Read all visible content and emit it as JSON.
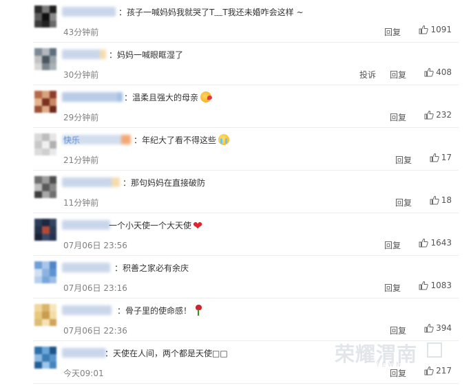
{
  "comments": [
    {
      "text": "：孩子一喊妈妈我就哭了T﹏T我还未婚咋会这样 ~",
      "time": "43分钟前",
      "reply": "回复",
      "report": "",
      "likes": "1091",
      "username": "",
      "emoji": "",
      "avatar_colors": [
        "#2b2b2b",
        "#7a7a7a",
        "#1e1e1e",
        "#5c5c5c",
        "#0f0f0f",
        "#8a8a8a",
        "#3a3a3a",
        "#222222",
        "#6a6a6a"
      ],
      "name_colors": [
        "#c9d6ea",
        "#b9c9e3"
      ]
    },
    {
      "text": "：妈妈一喊眼眶湿了",
      "time": "30分钟前",
      "reply": "回复",
      "report": "投诉",
      "likes": "408",
      "username": "",
      "emoji": "",
      "avatar_colors": [
        "#7b8a96",
        "#b3b8bd",
        "#5d6f7d",
        "#c2c2c2",
        "#4a5560",
        "#9aa4ab",
        "#d8d8d8",
        "#7c858c",
        "#a9b1b7"
      ],
      "name_colors": [
        "#c9d6ea",
        "#f5dcae"
      ]
    },
    {
      "text": "：温柔且强大的母亲",
      "time": "29分钟前",
      "reply": "回复",
      "report": "",
      "likes": "232",
      "username": "",
      "emoji": "kiss",
      "avatar_colors": [
        "#b56a4a",
        "#d9a17c",
        "#8c3e2c",
        "#e4b48e",
        "#7a3122",
        "#c98a63",
        "#9b5138",
        "#deae8a",
        "#6a2a1c"
      ],
      "name_colors": [
        "#b9cbe6",
        "#9fbde6"
      ]
    },
    {
      "text": "：年纪大了看不得这些",
      "time": "21分钟前",
      "reply": "回复",
      "report": "",
      "likes": "17",
      "username": "快乐",
      "emoji": "cry",
      "avatar_colors": [
        "#d9d9d9",
        "#bdbdbd",
        "#e6e6e6",
        "#c8c8c8",
        "#f0f0f0",
        "#b0b0b0",
        "#dcdcdc",
        "#cfcfcf",
        "#e9e9e9"
      ],
      "name_colors": [
        "#d2ddee",
        "#f2a874"
      ]
    },
    {
      "text": "：那句妈妈在直接破防",
      "time": "11分钟前",
      "reply": "回复",
      "report": "",
      "likes": "18",
      "username": "",
      "emoji": "",
      "avatar_colors": [
        "#6d6d6d",
        "#9d9d9d",
        "#4e4e4e",
        "#bfbfbf",
        "#5a5a5a",
        "#8a8a8a",
        "#3e3e3e",
        "#a8a8a8",
        "#707070"
      ],
      "name_colors": [
        "#c9d6ea",
        "#f5dcae"
      ]
    },
    {
      "text": "一个小天使一个大天使",
      "time": "07月06日 23:56",
      "reply": "回复",
      "report": "",
      "likes": "1643",
      "username": "",
      "emoji": "heart",
      "avatar_colors": [
        "#2c3b57",
        "#1c2740",
        "#34465f",
        "#223048",
        "#b24a3a",
        "#2a3952",
        "#1a2238",
        "#3a4a66",
        "#243352"
      ],
      "name_colors": [
        "#c9d6ea",
        "#bccde7"
      ]
    },
    {
      "text": "：积善之家必有余庆",
      "time": "07月06日 23:16",
      "reply": "回复",
      "report": "",
      "likes": "1083",
      "username": "",
      "emoji": "",
      "avatar_colors": [
        "#6f9fd6",
        "#a8c6ea",
        "#4f86c6",
        "#cfe0f3",
        "#8ab3e2",
        "#5c93d0",
        "#b5cfee",
        "#7aa7da",
        "#9dbde5"
      ],
      "name_colors": [
        "#c9d6ea",
        "#c4d3ea"
      ]
    },
    {
      "text": "：骨子里的使命感！",
      "time": "07月06日 22:36",
      "reply": "回复",
      "report": "",
      "likes": "394",
      "username": "",
      "emoji": "rose",
      "avatar_colors": [
        "#f1d79a",
        "#d9b46a",
        "#f7e5bb",
        "#e8c77e",
        "#c99c4e",
        "#f3dda6",
        "#dcbb74",
        "#f6e3b4",
        "#cfa35a"
      ],
      "name_colors": [
        "#c9d6ea",
        "#bccde7"
      ]
    },
    {
      "text": "：天使在人间，两个都是天使□□",
      "time": "今天09:01",
      "reply": "回复",
      "report": "",
      "likes": "217",
      "username": "",
      "emoji": "",
      "avatar_colors": [
        "#2f6fa8",
        "#6aa6d8",
        "#1f5286",
        "#8cbbe3",
        "#3d7db5",
        "#5a96cc",
        "#245f96",
        "#9cc6ea",
        "#4684bd"
      ],
      "name_colors": [
        "#c9d6ea",
        "#bccde7"
      ]
    }
  ],
  "watermark": {
    "text": "荣耀渭南",
    "url": "YEWN"
  },
  "colors": {
    "text": "#333333",
    "muted": "#808080",
    "link": "#555555",
    "separator": "#ececec"
  }
}
